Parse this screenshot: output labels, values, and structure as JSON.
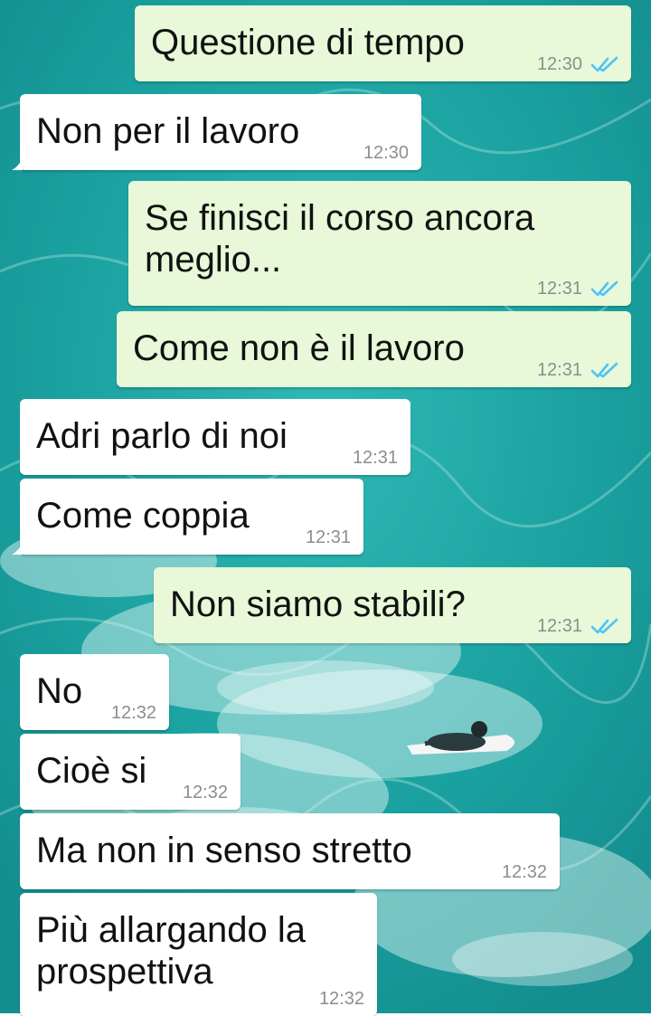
{
  "chat": {
    "colors": {
      "incoming_bubble": "#ffffff",
      "outgoing_bubble": "#e8f8d8",
      "read_ticks": "#4fc3f7",
      "wallpaper": "#1ea8a6"
    },
    "messages": [
      {
        "direction": "outgoing",
        "text": "Questione di tempo",
        "time": "12:30",
        "status": "read"
      },
      {
        "direction": "incoming",
        "text": "Non per il lavoro",
        "time": "12:30"
      },
      {
        "direction": "outgoing",
        "text": "Se finisci il corso ancora meglio...",
        "time": "12:31",
        "status": "read"
      },
      {
        "direction": "outgoing",
        "text": "Come non è il lavoro",
        "time": "12:31",
        "status": "read"
      },
      {
        "direction": "incoming",
        "text": "Adri parlo di noi",
        "time": "12:31"
      },
      {
        "direction": "incoming",
        "text": "Come coppia",
        "time": "12:31"
      },
      {
        "direction": "outgoing",
        "text": "Non siamo stabili?",
        "time": "12:31",
        "status": "read"
      },
      {
        "direction": "incoming",
        "text": "No",
        "time": "12:32"
      },
      {
        "direction": "incoming",
        "text": "Cioè si",
        "time": "12:32"
      },
      {
        "direction": "incoming",
        "text": "Ma non in senso stretto",
        "time": "12:32"
      },
      {
        "direction": "incoming",
        "text": "Più allargando la prospettiva",
        "time": "12:32"
      }
    ]
  }
}
